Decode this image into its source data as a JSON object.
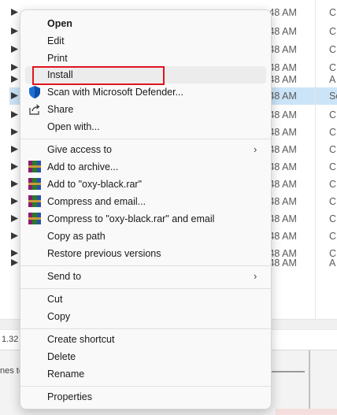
{
  "background": {
    "rows": [
      {
        "time": ":48 AM",
        "type": "C"
      },
      {
        "time": ":48 AM",
        "type": "C"
      },
      {
        "time": ":48 AM",
        "type": "C"
      },
      {
        "time": ":48 AM",
        "type": "C"
      },
      {
        "time": ":48 AM",
        "type": "A"
      },
      {
        "time": ":48 AM",
        "type": "Se",
        "selected": true
      },
      {
        "time": ":48 AM",
        "type": "C"
      },
      {
        "time": ":48 AM",
        "type": "C"
      },
      {
        "time": ":48 AM",
        "type": "C"
      },
      {
        "time": ":48 AM",
        "type": "C"
      },
      {
        "time": ":48 AM",
        "type": "C"
      },
      {
        "time": ":48 AM",
        "type": "C"
      },
      {
        "time": ":48 AM",
        "type": "C"
      },
      {
        "time": ":48 AM",
        "type": "C"
      },
      {
        "time": ":48 AM",
        "type": "C"
      },
      {
        "time": ":48 AM",
        "type": "A"
      }
    ],
    "status_text": "1.32",
    "bottom_text": "nes to"
  },
  "menu": {
    "items": [
      {
        "label": "Open",
        "bold": true
      },
      {
        "label": "Edit"
      },
      {
        "label": "Print"
      },
      {
        "label": "Install"
      },
      {
        "label": "Scan with Microsoft Defender...",
        "icon": "shield-icon"
      },
      {
        "label": "Share",
        "icon": "share-icon"
      },
      {
        "label": "Open with..."
      },
      {
        "label": "Give access to",
        "submenu": true
      },
      {
        "label": "Add to archive...",
        "icon": "winrar-icon"
      },
      {
        "label": "Add to \"oxy-black.rar\"",
        "icon": "winrar-icon"
      },
      {
        "label": "Compress and email...",
        "icon": "winrar-icon"
      },
      {
        "label": "Compress to \"oxy-black.rar\" and email",
        "icon": "winrar-icon"
      },
      {
        "label": "Copy as path"
      },
      {
        "label": "Restore previous versions"
      },
      {
        "label": "Send to",
        "submenu": true
      },
      {
        "label": "Cut"
      },
      {
        "label": "Copy"
      },
      {
        "label": "Create shortcut"
      },
      {
        "label": "Delete"
      },
      {
        "label": "Rename"
      },
      {
        "label": "Properties"
      }
    ],
    "submenu_arrow": "›"
  },
  "colors": {
    "highlight_box": "#e0141e",
    "menu_bg": "#f9f9f9",
    "selection_bg": "#cce4f7"
  }
}
